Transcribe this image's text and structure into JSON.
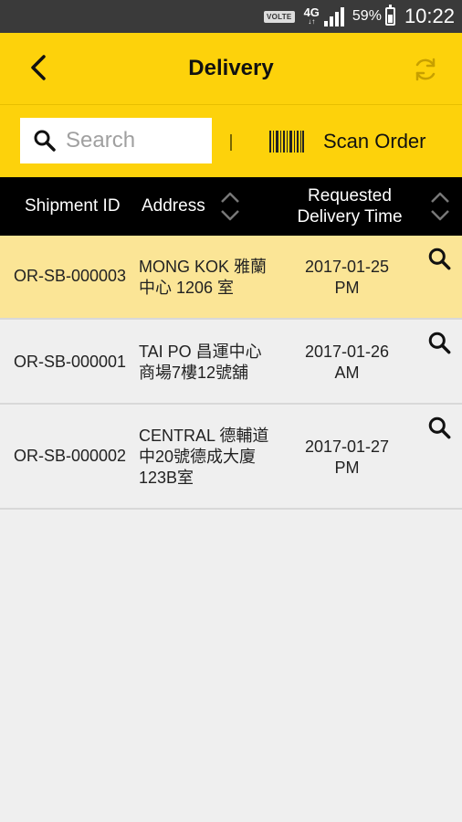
{
  "status_bar": {
    "volte": "VOLTE",
    "network": "4G",
    "network_sub": "↓↑",
    "battery_pct": "59%",
    "battery_level": 0.59,
    "time": "10:22"
  },
  "app_bar": {
    "title": "Delivery",
    "back_icon": "chevron-left-icon",
    "refresh_icon": "refresh-icon"
  },
  "search": {
    "placeholder": "Search",
    "value": ""
  },
  "scan": {
    "label": "Scan Order",
    "icon": "barcode-icon"
  },
  "table": {
    "headers": {
      "shipment_id": "Shipment ID",
      "address": "Address",
      "requested_line1": "Requested",
      "requested_line2": "Delivery Time"
    },
    "rows": [
      {
        "id": "OR-SB-000003",
        "addr1": "MONG KOK 雅蘭",
        "addr2": "中心 1206 室",
        "addr3": "",
        "time1": "2017-01-25",
        "time2": "PM"
      },
      {
        "id": "OR-SB-000001",
        "addr1": "TAI PO 昌運中心",
        "addr2": "商場7樓12號舖",
        "addr3": "",
        "time1": "2017-01-26",
        "time2": "AM"
      },
      {
        "id": "OR-SB-000002",
        "addr1": "CENTRAL 德輔道",
        "addr2": "中20號德成大廈",
        "addr3": "123B室",
        "time1": "2017-01-27",
        "time2": "PM"
      }
    ]
  },
  "colors": {
    "accent": "#fdd20b",
    "selected_row": "#fbe596",
    "header_bg": "#000000"
  }
}
